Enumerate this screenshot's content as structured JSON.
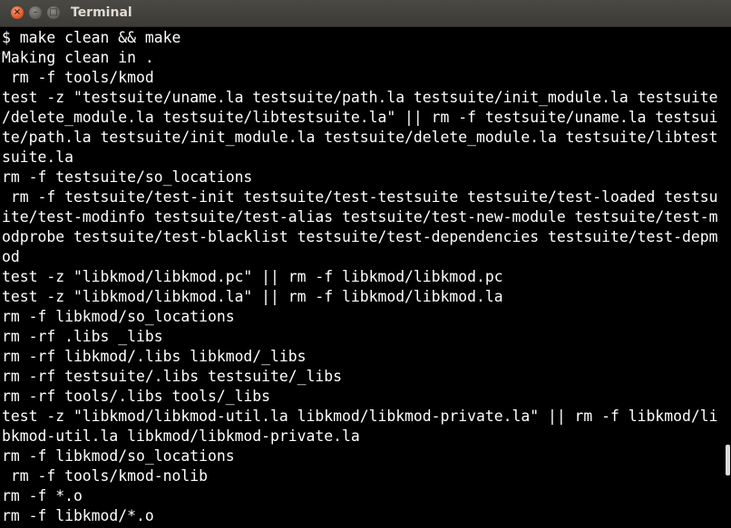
{
  "window": {
    "title": "Terminal",
    "close_glyph": "×",
    "min_glyph": "–",
    "max_glyph": "□"
  },
  "terminal": {
    "lines": [
      "$ make clean && make",
      "Making clean in .",
      " rm -f tools/kmod",
      "test -z \"testsuite/uname.la testsuite/path.la testsuite/init_module.la testsuite",
      "/delete_module.la testsuite/libtestsuite.la\" || rm -f testsuite/uname.la testsui",
      "te/path.la testsuite/init_module.la testsuite/delete_module.la testsuite/libtest",
      "suite.la",
      "rm -f testsuite/so_locations",
      " rm -f testsuite/test-init testsuite/test-testsuite testsuite/test-loaded testsu",
      "ite/test-modinfo testsuite/test-alias testsuite/test-new-module testsuite/test-m",
      "odprobe testsuite/test-blacklist testsuite/test-dependencies testsuite/test-depm",
      "od",
      "test -z \"libkmod/libkmod.pc\" || rm -f libkmod/libkmod.pc",
      "test -z \"libkmod/libkmod.la\" || rm -f libkmod/libkmod.la",
      "rm -f libkmod/so_locations",
      "rm -rf .libs _libs",
      "rm -rf libkmod/.libs libkmod/_libs",
      "rm -rf testsuite/.libs testsuite/_libs",
      "rm -rf tools/.libs tools/_libs",
      "test -z \"libkmod/libkmod-util.la libkmod/libkmod-private.la\" || rm -f libkmod/li",
      "bkmod-util.la libkmod/libkmod-private.la",
      "rm -f libkmod/so_locations",
      " rm -f tools/kmod-nolib",
      "rm -f *.o",
      "rm -f libkmod/*.o"
    ]
  },
  "colors": {
    "background": "#000000",
    "foreground": "#ffffff",
    "titlebar": "#3c3b37",
    "close_button": "#e4572b"
  }
}
